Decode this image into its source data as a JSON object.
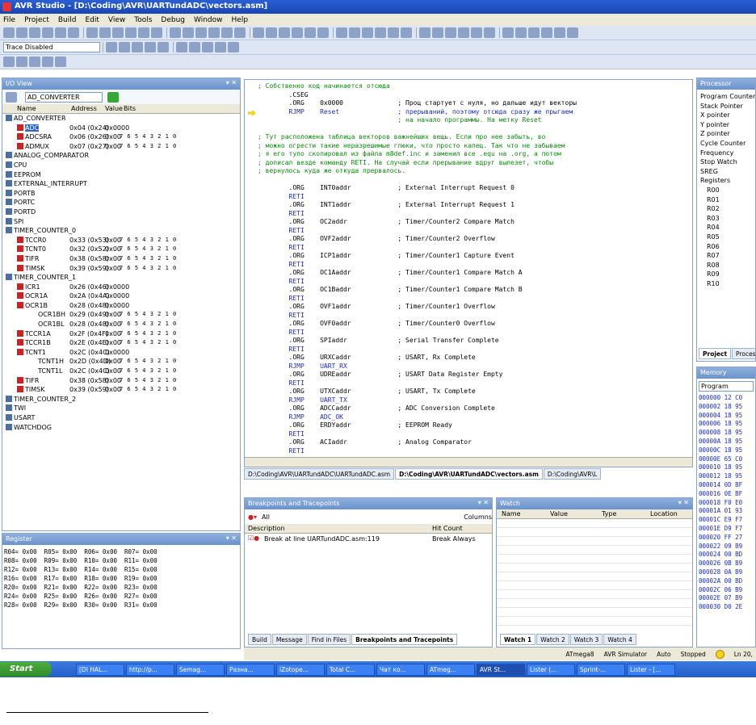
{
  "window": {
    "title": "AVR Studio - [D:\\Coding\\AVR\\UARTundADC\\vectors.asm]"
  },
  "menu": [
    "File",
    "Project",
    "Build",
    "Edit",
    "View",
    "Tools",
    "Debug",
    "Window",
    "Help"
  ],
  "toolbar": {
    "trace_combo": "Trace Disabled"
  },
  "io_view": {
    "title": "I/O View",
    "combo": "AD_CONVERTER",
    "columns": [
      "Name",
      "Address",
      "Value",
      "Bits"
    ],
    "rows": [
      {
        "name": "AD_CONVERTER",
        "addr": "",
        "val": "",
        "bits": ""
      },
      {
        "name": "ADC",
        "addr": "0x04 (0x24)",
        "val": "0x0000",
        "bits": ""
      },
      {
        "name": "ADCSRA",
        "addr": "0x06 (0x26)",
        "val": "0x00",
        "bits": "7 6 5 4 3 2 1 0"
      },
      {
        "name": "ADMUX",
        "addr": "0x07 (0x27)",
        "val": "0x00",
        "bits": "7 6 5 4 3 2 1 0"
      },
      {
        "name": "ANALOG_COMPARATOR",
        "addr": "",
        "val": "",
        "bits": ""
      },
      {
        "name": "CPU",
        "addr": "",
        "val": "",
        "bits": ""
      },
      {
        "name": "EEPROM",
        "addr": "",
        "val": "",
        "bits": ""
      },
      {
        "name": "EXTERNAL_INTERRUPT",
        "addr": "",
        "val": "",
        "bits": ""
      },
      {
        "name": "PORTB",
        "addr": "",
        "val": "",
        "bits": ""
      },
      {
        "name": "PORTC",
        "addr": "",
        "val": "",
        "bits": ""
      },
      {
        "name": "PORTD",
        "addr": "",
        "val": "",
        "bits": ""
      },
      {
        "name": "SPI",
        "addr": "",
        "val": "",
        "bits": ""
      },
      {
        "name": "TIMER_COUNTER_0",
        "addr": "",
        "val": "",
        "bits": ""
      },
      {
        "name": "TCCR0",
        "addr": "0x33 (0x53)",
        "val": "0x00",
        "bits": "7 6 5 4 3 2 1 0"
      },
      {
        "name": "TCNT0",
        "addr": "0x32 (0x52)",
        "val": "0x00",
        "bits": "7 6 5 4 3 2 1 0"
      },
      {
        "name": "TIFR",
        "addr": "0x38 (0x58)",
        "val": "0x00",
        "bits": "7 6 5 4 3 2 1 0"
      },
      {
        "name": "TIMSK",
        "addr": "0x39 (0x59)",
        "val": "0x00",
        "bits": "7 6 5 4 3 2 1 0"
      },
      {
        "name": "TIMER_COUNTER_1",
        "addr": "",
        "val": "",
        "bits": ""
      },
      {
        "name": "ICR1",
        "addr": "0x26 (0x46)",
        "val": "0x0000",
        "bits": ""
      },
      {
        "name": "OCR1A",
        "addr": "0x2A (0x4A)",
        "val": "0x0000",
        "bits": ""
      },
      {
        "name": "OCR1B",
        "addr": "0x28 (0x48)",
        "val": "0x0000",
        "bits": ""
      },
      {
        "name": "OCR1BH",
        "addr": "0x29 (0x49)",
        "val": "0x00",
        "bits": "7 6 5 4 3 2 1 0"
      },
      {
        "name": "OCR1BL",
        "addr": "0x28 (0x48)",
        "val": "0x00",
        "bits": "7 6 5 4 3 2 1 0"
      },
      {
        "name": "TCCR1A",
        "addr": "0x2F (0x4F)",
        "val": "0x00",
        "bits": "7 6 5 4 3 2 1 0"
      },
      {
        "name": "TCCR1B",
        "addr": "0x2E (0x4E)",
        "val": "0x00",
        "bits": "7 6 5 4 3 2 1 0"
      },
      {
        "name": "TCNT1",
        "addr": "0x2C (0x4C)",
        "val": "0x0000",
        "bits": ""
      },
      {
        "name": "TCNT1H",
        "addr": "0x2D (0x4D)",
        "val": "0x00",
        "bits": "7 6 5 4 3 2 1 0"
      },
      {
        "name": "TCNT1L",
        "addr": "0x2C (0x4C)",
        "val": "0x00",
        "bits": "7 6 5 4 3 2 1 0"
      },
      {
        "name": "TIFR",
        "addr": "0x38 (0x58)",
        "val": "0x00",
        "bits": "7 6 5 4 3 2 1 0"
      },
      {
        "name": "TIMSK",
        "addr": "0x39 (0x59)",
        "val": "0x00",
        "bits": "7 6 5 4 3 2 1 0"
      },
      {
        "name": "TIMER_COUNTER_2",
        "addr": "",
        "val": "",
        "bits": ""
      },
      {
        "name": "TWI",
        "addr": "",
        "val": "",
        "bits": ""
      },
      {
        "name": "USART",
        "addr": "",
        "val": "",
        "bits": ""
      },
      {
        "name": "WATCHDOG",
        "addr": "",
        "val": "",
        "bits": ""
      }
    ]
  },
  "register_panel": {
    "title": "Register",
    "lines": [
      "R04= 0x00  R05= 0x00  R06= 0x00  R07= 0x00",
      "R08= 0x00  R09= 0x00  R10= 0x00  R11= 0x00",
      "R12= 0x00  R13= 0x00  R14= 0x00  R15= 0x00",
      "R16= 0x00  R17= 0x00  R18= 0x00  R19= 0x00",
      "R20= 0x00  R21= 0x00  R22= 0x00  R23= 0x00",
      "R24= 0x00  R25= 0x00  R26= 0x00  R27= 0x00",
      "R28= 0x00  R29= 0x00  R30= 0x00  R31= 0x00"
    ]
  },
  "code": {
    "lines": [
      "; Собственно код начинается отсюда",
      "        .CSEG",
      "        .ORG    0x0000              ; Проц стартует с нуля, но дальше идут векторы",
      "        RJMP    Reset               ; прерываний, поэтому отсюда сразу же прыгаем",
      "                                    ; на начало программы. На метку Reset",
      "",
      "; Тут расположена таблица векторов важнейших вещь. Если про нее забыть, во",
      "; можно огрести такие неразрешимые глюки, что просто капец. Так что не забываем",
      "; я его тупо скопировал из файла m8def.inc и заменил все .equ на .org, а потом",
      "; дописал везде команду RETI. На случай если прерывание вдруг вылезет, чтобы",
      "; вернулось куда же откуда прервалось.",
      "",
      "        .ORG    INT0addr            ; External Interrupt Request 0",
      "        RETI",
      "        .ORG    INT1addr            ; External Interrupt Request 1",
      "        RETI",
      "        .ORG    OC2addr             ; Timer/Counter2 Compare Match",
      "        RETI",
      "        .ORG    OVF2addr            ; Timer/Counter2 Overflow",
      "        RETI",
      "        .ORG    ICP1addr            ; Timer/Counter1 Capture Event",
      "        RETI",
      "        .ORG    OC1Aaddr            ; Timer/Counter1 Compare Match A",
      "        RETI",
      "        .ORG    OC1Baddr            ; Timer/Counter1 Compare Match B",
      "        RETI",
      "        .ORG    OVF1addr            ; Timer/Counter1 Overflow",
      "        RETI",
      "        .ORG    OVF0addr            ; Timer/Counter0 Overflow",
      "        RETI",
      "        .ORG    SPIaddr             ; Serial Transfer Complete",
      "        RETI",
      "        .ORG    URXCaddr            ; USART, Rx Complete",
      "        RJMP    UART_RX",
      "        .ORG    UDREaddr            ; USART Data Register Empty",
      "        RETI",
      "        .ORG    UTXCaddr            ; USART, Tx Complete",
      "        RJMP    UART_TX",
      "        .ORG    ADCCaddr            ; ADC Conversion Complete",
      "        RJMP    ADC_OK",
      "        .ORG    ERDYaddr            ; EEPROM Ready",
      "        RETI",
      "        .ORG    ACIaddr             ; Analog Comparator",
      "        RETI"
    ]
  },
  "doc_tabs": [
    "D:\\Coding\\AVR\\UARTundADC\\UARTundADC.asm",
    "D:\\Coding\\AVR\\UARTundADC\\vectors.asm",
    "D:\\Coding\\AVR\\L"
  ],
  "breakpoints": {
    "title": "Breakpoints and Tracepoints",
    "filter": "All",
    "columns_btn": "Columns",
    "headers": [
      "Description",
      "Hit Count"
    ],
    "items": [
      {
        "desc": "Break at line UARTundADC.asm:119",
        "hit": "Break Always"
      }
    ]
  },
  "bottom_tabs": [
    "Build",
    "Message",
    "Find in Files",
    "Breakpoints and Tracepoints"
  ],
  "watch": {
    "title": "Watch",
    "headers": [
      "Name",
      "Value",
      "Type",
      "Location"
    ],
    "tabs": [
      "Watch 1",
      "Watch 2",
      "Watch 3",
      "Watch 4"
    ]
  },
  "processor": {
    "title": "Processor",
    "items": [
      "Program Counter",
      "Stack Pointer",
      "X pointer",
      "Y pointer",
      "Z pointer",
      "Cycle Counter",
      "Frequency",
      "Stop Watch",
      "SREG",
      "Registers",
      "R00",
      "R01",
      "R02",
      "R03",
      "R04",
      "R05",
      "R06",
      "R07",
      "R08",
      "R09",
      "R10"
    ],
    "tabs": [
      "Project",
      "Processor"
    ]
  },
  "memory": {
    "title": "Memory",
    "combo": "Program",
    "lines": [
      "000000 12 C0",
      "000002 18 95",
      "000004 18 95",
      "000006 18 95",
      "000008 18 95",
      "00000A 18 95",
      "00000C 18 95",
      "00000E 65 C0",
      "000010 18 95",
      "000012 18 95",
      "000014 0D BF",
      "000016 0E BF",
      "000018 F0 E0",
      "00001A 01 93",
      "00001C E9 F7",
      "00001E D9 F7",
      "000020 FF 27",
      "000022 09 B9",
      "000024 00 BD",
      "000026 0B B9",
      "000028 0A B9",
      "00002A 00 BD",
      "00002C 06 B9",
      "00002E 07 B9",
      "000030 D0 2E"
    ]
  },
  "status": {
    "device": "ATmega8",
    "sim": "AVR Simulator",
    "mode": "Auto",
    "state": "Stopped",
    "pos": "Ln 20,"
  },
  "taskbar": {
    "start": "Start",
    "tasks": [
      "[DI HAL...",
      "http://p...",
      "Semag...",
      "Разна...",
      "iZotope...",
      "Total C...",
      "Чат ко...",
      "ATmeg...",
      "AVR St...",
      "Lister (...",
      "Sprint-...",
      "Lister - [..."
    ]
  }
}
